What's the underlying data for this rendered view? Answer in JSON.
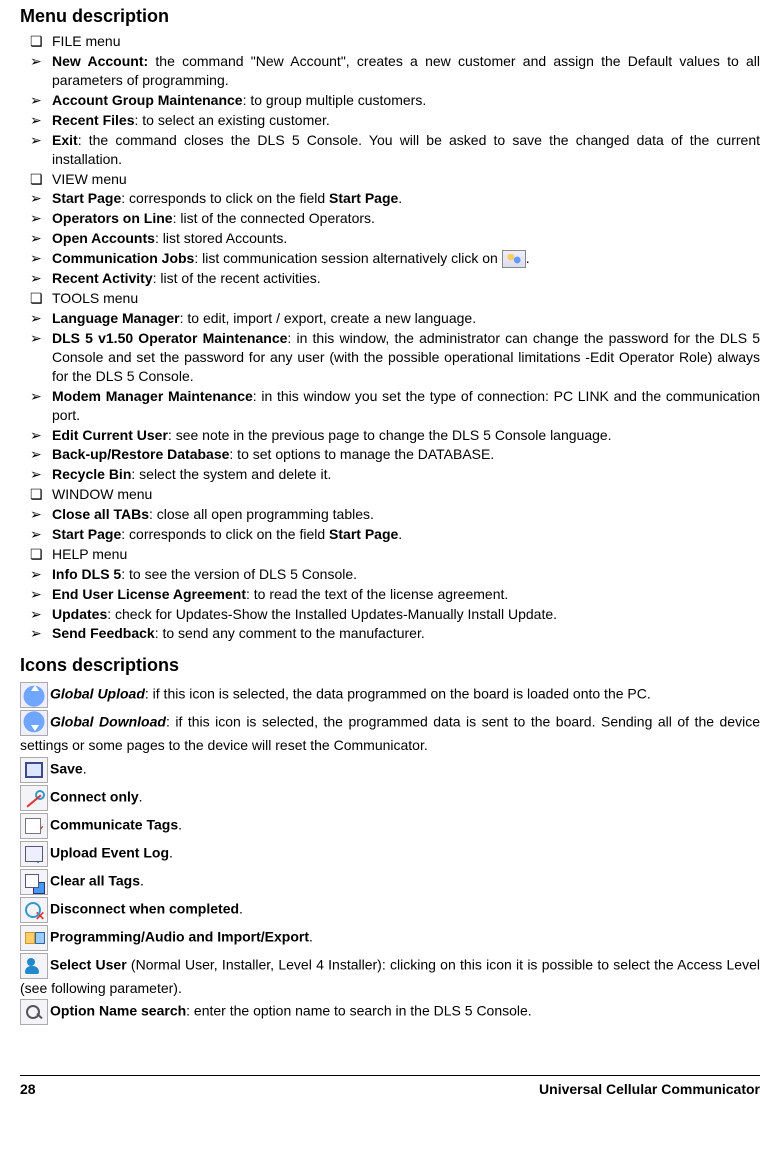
{
  "headings": {
    "menu": "Menu description",
    "icons": "Icons descriptions"
  },
  "menu_items": [
    {
      "k": "sq",
      "b": "",
      "t": "FILE menu"
    },
    {
      "k": "ar",
      "b": "New Account:",
      "t": " the command \"New Account\", creates a new customer and assign the Default values to all parameters of programming."
    },
    {
      "k": "ar",
      "b": "Account Group Maintenance",
      "t": ": to group multiple customers."
    },
    {
      "k": "ar",
      "b": "Recent Files",
      "t": ": to select an existing customer."
    },
    {
      "k": "ar",
      "b": "Exit",
      "t": ": the command closes the DLS 5 Console. You will be asked to save the changed data of the current installation."
    },
    {
      "k": "sq",
      "b": "",
      "t": "VIEW menu"
    },
    {
      "k": "ar",
      "b": "Start Page",
      "t": ": corresponds to click on the field ",
      "b2": "Start Page",
      "tail": "."
    },
    {
      "k": "ar",
      "b": "Operators on Line",
      "t": ": list of the connected Operators."
    },
    {
      "k": "ar",
      "b": "Open Accounts",
      "t": ": list stored Accounts."
    },
    {
      "k": "ar",
      "b": "Communication Jobs",
      "t": ": list communication session alternatively click on ",
      "icon": true,
      "tail": "."
    },
    {
      "k": "ar",
      "b": "Recent Activity",
      "t": ": list of the recent activities."
    },
    {
      "k": "sq",
      "b": "",
      "t": "TOOLS menu"
    },
    {
      "k": "ar",
      "b": "Language Manager",
      "t": ": to edit, import / export, create a new language."
    },
    {
      "k": "ar",
      "b": "DLS 5 v1.50 Operator Maintenance",
      "t": ": in this window, the administrator can change the password for the DLS 5 Console and set the password for any user (with the possible operational limitations -Edit Operator Role) always for the DLS 5 Console."
    },
    {
      "k": "ar",
      "b": "Modem Manager Maintenance",
      "t": ": in this window you set the type of connection: PC LINK and the communication port."
    },
    {
      "k": "ar",
      "b": "Edit Current User",
      "t": ": see note in the previous page to change the DLS 5 Console language."
    },
    {
      "k": "ar",
      "b": "Back-up/Restore Database",
      "t": ": to set options to manage the DATABASE."
    },
    {
      "k": "ar",
      "b": "Recycle Bin",
      "t": ": select the system and delete it."
    },
    {
      "k": "sq",
      "b": "",
      "t": "WINDOW menu"
    },
    {
      "k": "ar",
      "b": "Close all TABs",
      "t": ": close all open programming tables."
    },
    {
      "k": "ar",
      "b": "Start Page",
      "t": ": corresponds to click on the field ",
      "b2": "Start Page",
      "tail": "."
    },
    {
      "k": "sq",
      "b": "",
      "t": "HELP menu"
    },
    {
      "k": "ar",
      "b": "Info DLS 5",
      "t": ": to see the version of DLS 5 Console."
    },
    {
      "k": "ar",
      "b": "End User License Agreement",
      "t": ": to read the text of the license agreement."
    },
    {
      "k": "ar",
      "b": "Updates",
      "t": ": check for Updates-Show the Installed Updates-Manually Install Update."
    },
    {
      "k": "ar",
      "b": "Send Feedback",
      "t": ": to send any comment to the manufacturer."
    }
  ],
  "icon_items": [
    {
      "cls": "ic-gup",
      "bi": "Global Upload",
      "t": ": if this icon is selected, the data programmed on the board is loaded onto the PC."
    },
    {
      "cls": "ic-gdn",
      "bi": "Global Download",
      "t": ": if this icon is selected, the programmed data is sent to the board. Sending all of the device settings or some pages to the device will reset the Communicator.",
      "wrap": true
    },
    {
      "cls": "ic-save",
      "b": "Save",
      "t": "."
    },
    {
      "cls": "ic-conn",
      "b": "Connect only",
      "t": "."
    },
    {
      "cls": "ic-ctag",
      "b": "Communicate Tags",
      "t": "."
    },
    {
      "cls": "ic-uel",
      "b": "Upload Event Log",
      "t": "."
    },
    {
      "cls": "ic-clr",
      "b": "Clear all Tags",
      "t": "."
    },
    {
      "cls": "ic-disc",
      "b": "Disconnect when completed",
      "t": "."
    },
    {
      "cls": "ic-prog",
      "b": "Programming/Audio and Import/Export",
      "t": "."
    },
    {
      "cls": "ic-user",
      "b": "Select User",
      "t": " (Normal User, Installer, Level 4 Installer): clicking on this icon it is possible to select the Access Level (see following parameter).",
      "wrap": true
    },
    {
      "cls": "ic-srch",
      "b": "Option Name search",
      "t": ": enter the option name to search in the DLS 5 Console."
    }
  ],
  "footer": {
    "page": "28",
    "title": "Universal Cellular Communicator"
  }
}
